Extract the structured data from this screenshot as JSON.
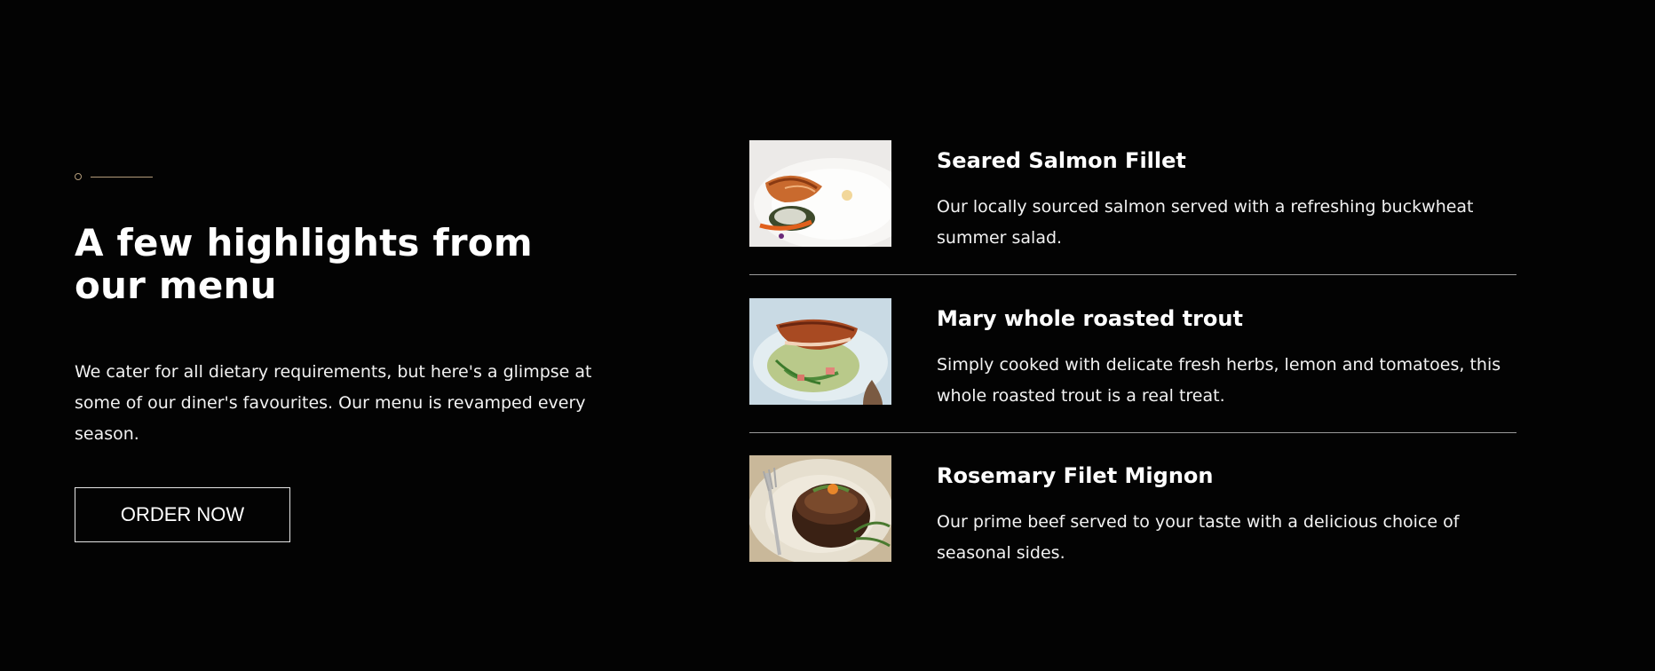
{
  "section": {
    "heading": "A few highlights from our menu",
    "intro": "We cater for all dietary requirements, but here's a glimpse at some of our diner's favourites. Our menu is revamped every season.",
    "order_button": "ORDER NOW"
  },
  "menu": {
    "items": [
      {
        "title": "Seared Salmon Fillet",
        "description": "Our locally sourced salmon served with a refreshing buckwheat summer salad."
      },
      {
        "title": "Mary whole roasted trout",
        "description": "Simply cooked with delicate fresh herbs, lemon and tomatoes, this whole roasted trout is a real treat."
      },
      {
        "title": "Rosemary Filet Mignon",
        "description": "Our prime beef served to your taste with a delicious choice of seasonal sides."
      }
    ]
  },
  "colors": {
    "background": "#030303",
    "text": "#ffffff",
    "accent": "#b39b7a",
    "divider": "#9a9a9a"
  }
}
